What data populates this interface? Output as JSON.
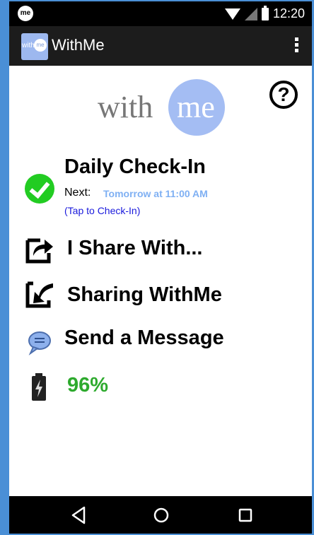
{
  "status_bar": {
    "time": "12:20",
    "app_icon_text": "me",
    "icons": [
      "wifi-icon",
      "signal-icon",
      "battery-icon"
    ]
  },
  "app_bar": {
    "title": "WithMe",
    "logo_with": "with",
    "logo_me": "me",
    "menu_icon": "overflow-menu-icon"
  },
  "logo": {
    "with": "with",
    "me": "me"
  },
  "help": {
    "glyph": "?"
  },
  "checkin": {
    "title": "Daily Check-In",
    "next_label": "Next:",
    "next_value": "Tomorrow at 11:00 AM",
    "tap_label": "(Tap to Check-In)"
  },
  "menu": {
    "share": "I Share With...",
    "sharing": "Sharing WithMe",
    "message": "Send a Message"
  },
  "battery": {
    "percent": "96%",
    "level": 0.96
  },
  "colors": {
    "accent_blue": "#a4bdf3",
    "link_blue": "#1a1adc",
    "next_blue": "#7fb0f3",
    "success_green": "#22cc22",
    "percent_green": "#2eaa2e"
  },
  "nav_bar": {
    "buttons": [
      "back-icon",
      "home-icon",
      "recents-icon"
    ]
  }
}
